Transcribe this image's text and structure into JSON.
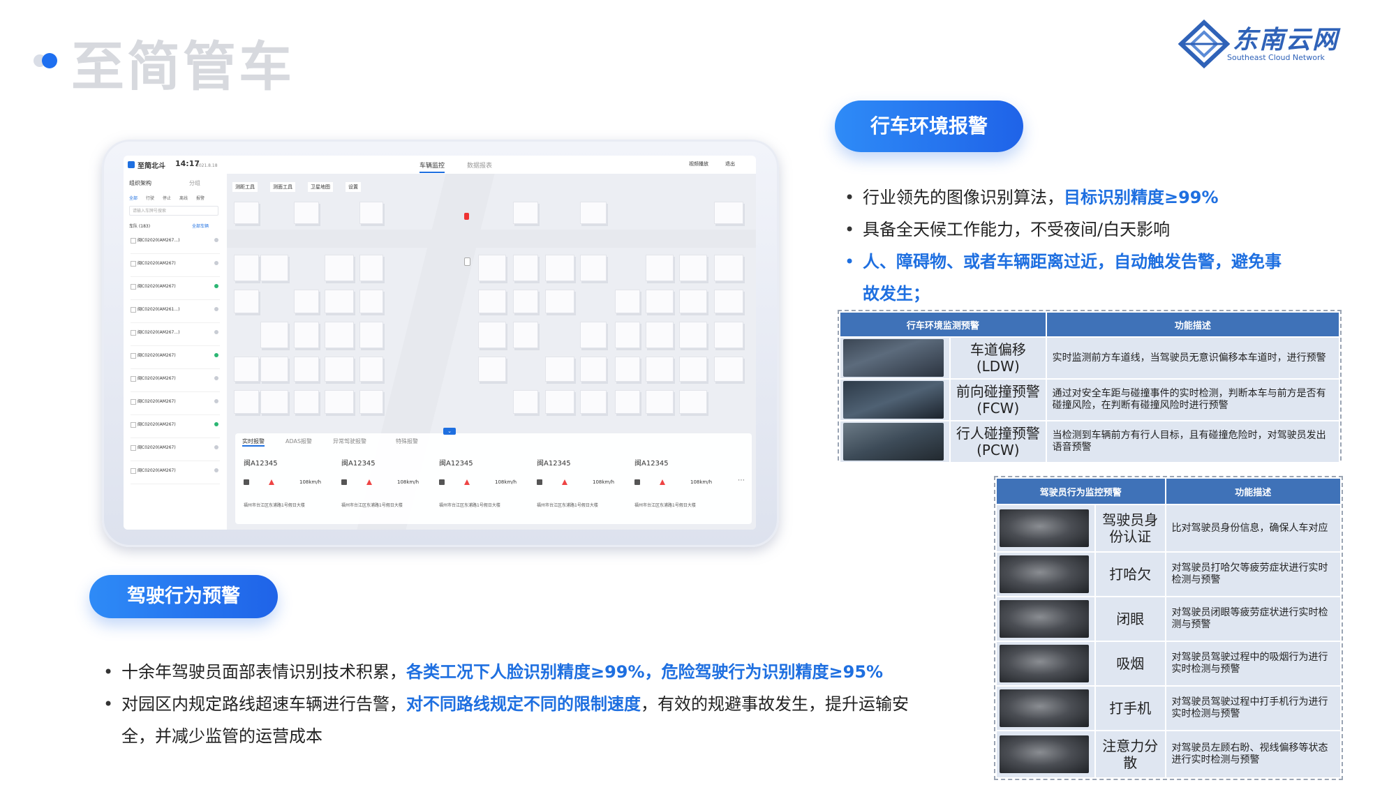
{
  "page_title": "至简管车",
  "logo": {
    "name": "东南云网",
    "subtitle": "Southeast Cloud Network"
  },
  "env_section": {
    "pill": "行车环境报警",
    "bullets": [
      {
        "text": "行业领先的图像识别算法，",
        "highlight": "目标识别精度≥99%"
      },
      {
        "text": "具备全天候工作能力，不受夜间/白天影响",
        "highlight": ""
      },
      {
        "text": "",
        "highlight": "人、障碍物、或者车辆距离过近，自动触发告警，避免事故发生；"
      }
    ],
    "table": {
      "headers": [
        "行车环境监测预警",
        "功能描述"
      ],
      "rows": [
        {
          "name_line1": "车道偏移",
          "name_line2": "(LDW)",
          "desc": "实时监测前方车道线，当驾驶员无意识偏移本车道时，进行预警"
        },
        {
          "name_line1": "前向碰撞预警",
          "name_line2": "(FCW)",
          "desc": "通过对安全车距与碰撞事件的实时检测，判断本车与前方是否有碰撞风险，在判断有碰撞风险时进行预警"
        },
        {
          "name_line1": "行人碰撞预警",
          "name_line2": "(PCW)",
          "desc": "当检测到车辆前方有行人目标，且有碰撞危险时，对驾驶员发出语音预警"
        }
      ]
    }
  },
  "driver_section": {
    "pill": "驾驶行为预警",
    "bullets": [
      {
        "text": "十余年驾驶员面部表情识别技术积累，",
        "highlight": "各类工况下人脸识别精度≥99%，危险驾驶行为识别精度≥95%",
        "tail": ""
      },
      {
        "text": "对园区内规定路线超速车辆进行告警，",
        "highlight": "对不同路线规定不同的限制速度",
        "tail": "，有效的规避事故发生，提升运输安全，并减少监管的运营成本"
      }
    ],
    "table": {
      "headers": [
        "驾驶员行为监控预警",
        "功能描述"
      ],
      "rows": [
        {
          "name": "驾驶员身份认证",
          "desc": "比对驾驶员身份信息，确保人车对应"
        },
        {
          "name": "打哈欠",
          "desc": "对驾驶员打哈欠等疲劳症状进行实时检测与预警"
        },
        {
          "name": "闭眼",
          "desc": "对驾驶员闭眼等疲劳症状进行实时检测与预警"
        },
        {
          "name": "吸烟",
          "desc": "对驾驶员驾驶过程中的吸烟行为进行实时检测与预警"
        },
        {
          "name": "打手机",
          "desc": "对驾驶员驾驶过程中打手机行为进行实时检测与预警"
        },
        {
          "name": "注意力分散",
          "desc": "对驾驶员左顾右盼、视线偏移等状态进行实时检测与预警"
        }
      ]
    }
  },
  "tablet_app": {
    "brand": "至简北斗",
    "time": "14:17",
    "date": "2021.8.18",
    "nav_tabs": [
      "车辆监控",
      "数据报表"
    ],
    "top_actions": [
      "视频播放",
      "退出"
    ],
    "sidebar_tabs": [
      "组织架构",
      "分组"
    ],
    "filter_tabs": [
      "全部",
      "行驶",
      "停止",
      "离线",
      "报警"
    ],
    "search_placeholder": "请输入车牌号搜索",
    "fleet_label": "车队",
    "fleet_count": "(183)",
    "all_label": "全部车辆",
    "vehicles": [
      "闽C02020(AM267...)",
      "闽C02020(AM267)",
      "闽C02020(AM267)",
      "闽C02020(AM261...)",
      "闽C02020(AM267...)",
      "闽C02020(AM267)",
      "闽C02020(AM267)",
      "闽C02020(AM267)",
      "闽C02020(AM267)",
      "闽C02020(AM267)",
      "闽C02020(AM267)"
    ],
    "map_toolbar": [
      "测距工具",
      "测面工具",
      "卫星地图",
      "设置"
    ],
    "alert_tabs": [
      "实时报警",
      "ADAS报警",
      "异常驾驶报警",
      "特殊报警"
    ],
    "alert_cards": [
      {
        "plate": "闽A12345",
        "speed": "108km/h",
        "addr": "福州市台江区东浦路1号假日大楼"
      },
      {
        "plate": "闽A12345",
        "speed": "108km/h",
        "addr": "福州市台江区东浦路1号假日大楼"
      },
      {
        "plate": "闽A12345",
        "speed": "108km/h",
        "addr": "福州市台江区东浦路1号假日大楼"
      },
      {
        "plate": "闽A12345",
        "speed": "108km/h",
        "addr": "福州市台江区东浦路1号假日大楼"
      },
      {
        "plate": "闽A12345",
        "speed": "108km/h",
        "addr": "福州市台江区东浦路1号假日大楼"
      }
    ]
  },
  "colors": {
    "accent": "#1e6fe0",
    "table_header": "#3f72b8",
    "table_cell": "#dfe6f1",
    "title_gray": "#d7d9de"
  }
}
